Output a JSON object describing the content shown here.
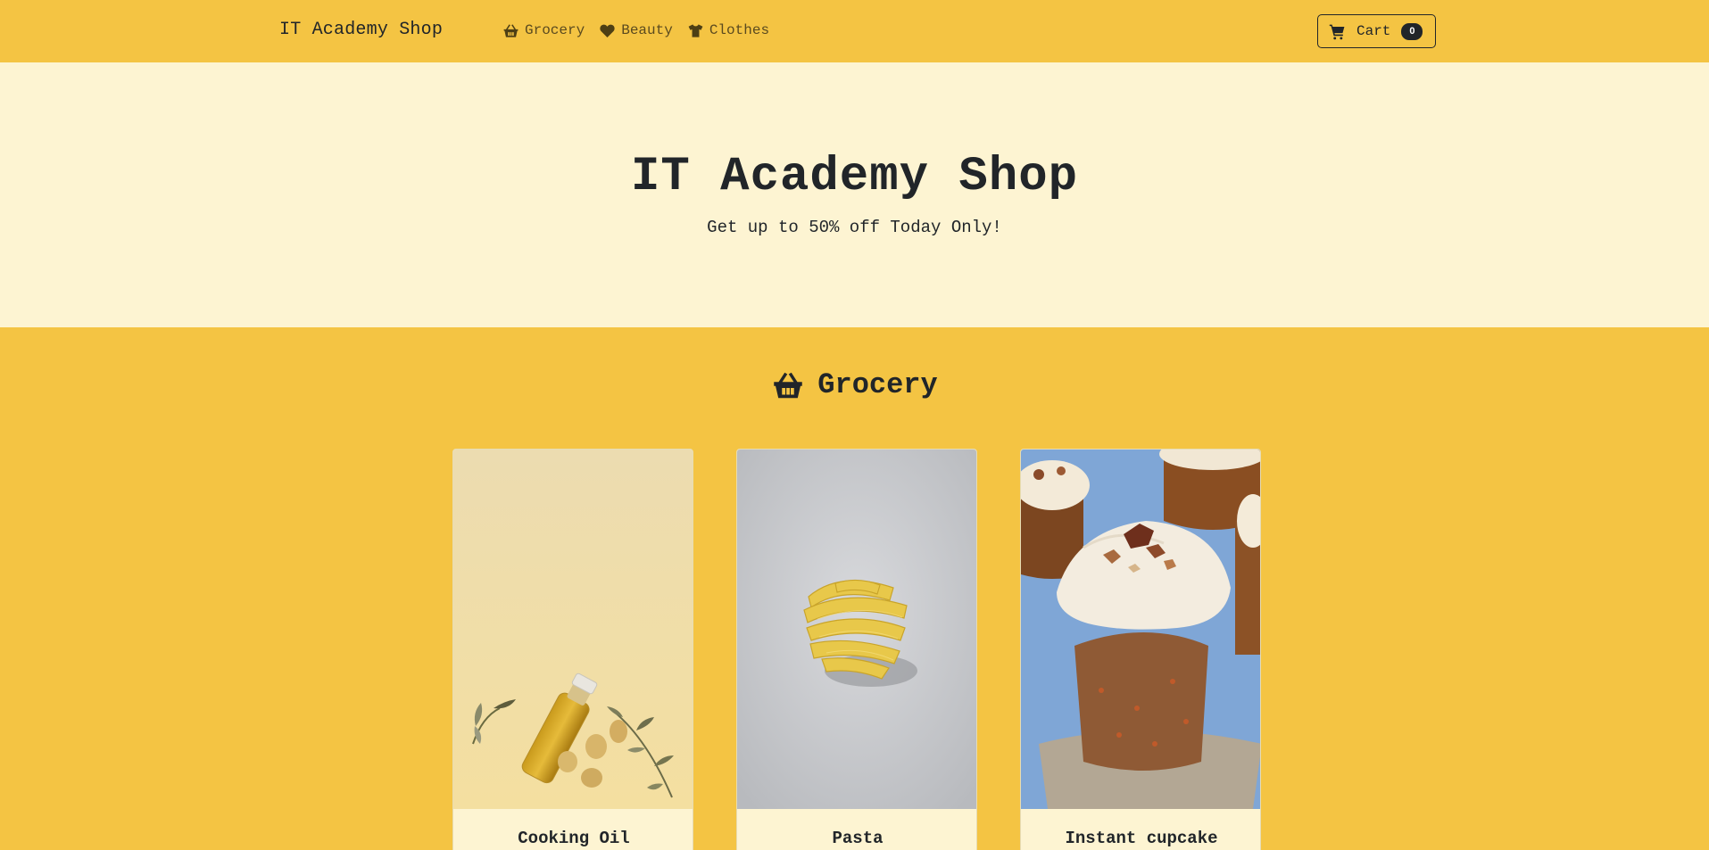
{
  "navbar": {
    "brand": "IT Academy Shop",
    "links": [
      {
        "label": "Grocery",
        "icon": "basket-icon"
      },
      {
        "label": "Beauty",
        "icon": "heart-icon"
      },
      {
        "label": "Clothes",
        "icon": "shirt-icon"
      }
    ],
    "cart": {
      "label": "Cart",
      "count": "0",
      "icon": "cart-icon"
    }
  },
  "hero": {
    "title": "IT Academy Shop",
    "subtitle": "Get up to 50% off Today Only!"
  },
  "section": {
    "title": "Grocery",
    "icon": "basket-icon",
    "products": [
      {
        "name": "Cooking Oil",
        "image": "olive-oil-bottle-photo"
      },
      {
        "name": "Pasta",
        "image": "pasta-nest-photo"
      },
      {
        "name": "Instant cupcake",
        "image": "carrot-cupcake-photo"
      }
    ]
  },
  "colors": {
    "accent": "#f4c443",
    "hero_bg": "#fdf4d2",
    "text": "#212529"
  }
}
